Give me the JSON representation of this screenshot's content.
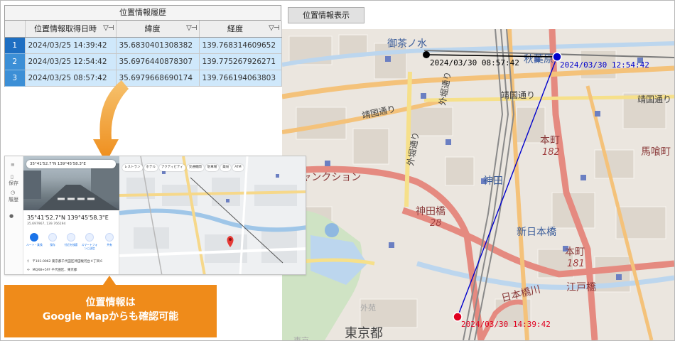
{
  "history": {
    "title": "位置情報履歴",
    "columns": [
      "位置情報取得日時",
      "緯度",
      "経度"
    ],
    "filter_icon": "filter-icon",
    "pin_icon": "pin-icon",
    "rows": [
      {
        "num": "1",
        "datetime": "2024/03/25 14:39:42",
        "lat": "35.6830401308382",
        "lng": "139.768314609652"
      },
      {
        "num": "2",
        "datetime": "2024/03/25 12:54:42",
        "lat": "35.6976440878307",
        "lng": "139.775267926271"
      },
      {
        "num": "3",
        "datetime": "2024/03/25 08:57:42",
        "lat": "35.6979668690174",
        "lng": "139.766194063803"
      }
    ]
  },
  "toolbar": {
    "show_location_label": "位置情報表示"
  },
  "map": {
    "labels": {
      "ochanomizu": "御茶ノ水",
      "akihabara": "秋葉原",
      "yasukuni": "靖国通り",
      "yasukuni2": "靖国通り",
      "sotobori": "外堀通り",
      "sotobori2": "外堀通り",
      "honcho_top": "本町",
      "honcho_top_num": "182",
      "bakuro": "馬喰町",
      "kanda": "神田",
      "junction": "橋ジャンクション",
      "kandabashi": "神田橋",
      "kandabashi_num": "28",
      "shinnihonbashi": "新日本橋",
      "honcho_bottom": "本町",
      "honcho_bottom_num": "181",
      "edobashi": "江戸橋",
      "nihonbashigawa": "日本橋川",
      "tokyoto": "東京都",
      "gaien": "外苑",
      "tokyo_small": "東京"
    },
    "markers": [
      {
        "label": "2024/03/30 08:57:42",
        "color": "#000000"
      },
      {
        "label": "2024/03/30 12:54:42",
        "color": "#0000cc"
      },
      {
        "label": "2024/03/30 14:39:42",
        "color": "#e00020"
      }
    ],
    "route_color": "#0000cc"
  },
  "gmap": {
    "search_value": "35°41'52.7\"N 139°45'58.3\"E",
    "coord_title": "35°41'52.7\"N 139°45'58.3\"E",
    "coord_sub": "35.697967, 139.766194",
    "rail": [
      "保存",
      "履歴"
    ],
    "actions": [
      "ルート・乗換",
      "保存",
      "付近を検索",
      "スマートフォンに送信",
      "共有"
    ],
    "address1": "〒101-0062 東京都千代田区神田駿河台４丁目６",
    "address2": "MQX8+5FF 千代田区、東京都",
    "chips": [
      "レストラン",
      "ホテル",
      "アクティビティ",
      "交通機関",
      "駐車場",
      "薬局",
      "ATM"
    ]
  },
  "callout": {
    "line1": "位置情報は",
    "line2": "Google Mapからも確認可能"
  }
}
